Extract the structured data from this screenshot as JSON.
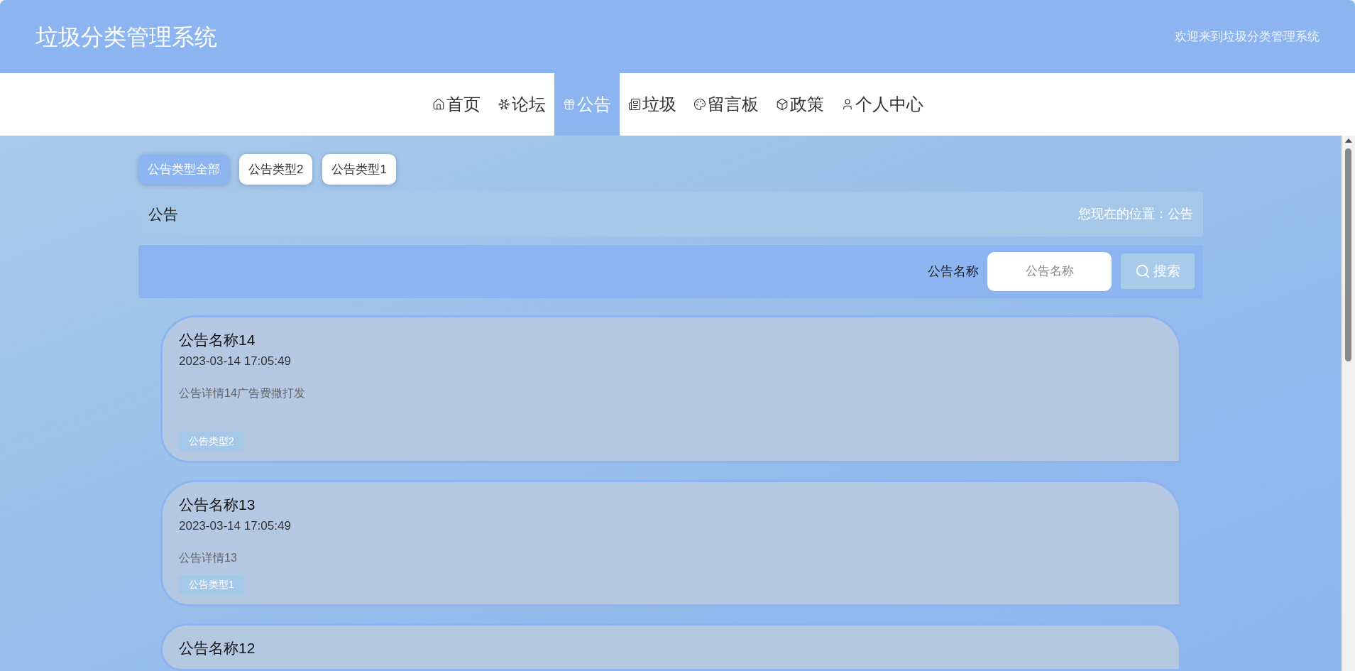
{
  "header": {
    "title": "垃圾分类管理系统",
    "welcome": "欢迎来到垃圾分类管理系统"
  },
  "nav": [
    {
      "label": "首页",
      "selected": false
    },
    {
      "label": "论坛",
      "selected": false
    },
    {
      "label": "公告",
      "selected": true
    },
    {
      "label": "垃圾",
      "selected": false
    },
    {
      "label": "留言板",
      "selected": false
    },
    {
      "label": "政策",
      "selected": false
    },
    {
      "label": "个人中心",
      "selected": false
    }
  ],
  "filters": [
    {
      "label": "公告类型全部",
      "selected": true
    },
    {
      "label": "公告类型2",
      "selected": false
    },
    {
      "label": "公告类型1",
      "selected": false
    }
  ],
  "breadcrumb": {
    "title": "公告",
    "location": "您现在的位置：公告"
  },
  "search": {
    "label": "公告名称",
    "placeholder": "公告名称",
    "button": "搜索"
  },
  "cards": [
    {
      "title": "公告名称14",
      "date": "2023-03-14 17:05:49",
      "description": "公告详情14广告费撒打发",
      "tag": "公告类型2"
    },
    {
      "title": "公告名称13",
      "date": "2023-03-14 17:05:49",
      "description": "公告详情13",
      "tag": "公告类型1"
    },
    {
      "title": "公告名称12"
    }
  ]
}
